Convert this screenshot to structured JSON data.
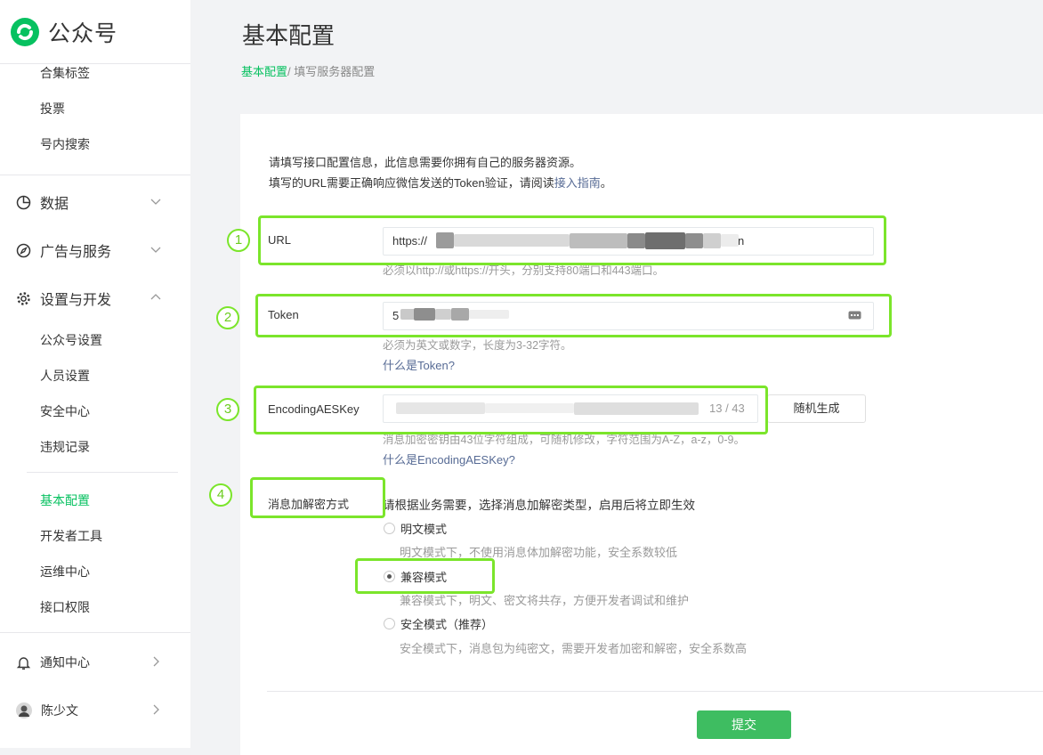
{
  "app": {
    "name": "公众号"
  },
  "sidebar": {
    "top_items": [
      "合集标签",
      "投票",
      "号内搜索"
    ],
    "sections": {
      "data": {
        "label": "数据"
      },
      "ads": {
        "label": "广告与服务"
      },
      "settings": {
        "label": "设置与开发"
      }
    },
    "settings_items": [
      "公众号设置",
      "人员设置",
      "安全中心",
      "违规记录"
    ],
    "dev_items": [
      "基本配置",
      "开发者工具",
      "运维中心",
      "接口权限"
    ],
    "notifications": {
      "label": "通知中心"
    },
    "user": {
      "name": "陈少文"
    }
  },
  "page": {
    "title": "基本配置",
    "breadcrumb": {
      "parent": "基本配置",
      "current": "/ 填写服务器配置"
    }
  },
  "form": {
    "intro_line1": "请填写接口配置信息，此信息需要你拥有自己的服务器资源。",
    "intro_line2_prefix": "填写的URL需要正确响应微信发送的Token验证，请阅读",
    "intro_link": "接入指南",
    "intro_line2_suffix": "。",
    "url": {
      "label": "URL",
      "value_prefix": "https://",
      "value_suffix": "n",
      "hint": "必须以http://或https://开头，分别支持80端口和443端口。"
    },
    "token": {
      "label": "Token",
      "value_prefix": "5",
      "hint": "必须为英文或数字，长度为3-32字符。",
      "link": "什么是Token?"
    },
    "aeskey": {
      "label": "EncodingAESKey",
      "counter": "13 / 43",
      "generate_label": "随机生成",
      "hint": "消息加密密钥由43位字符组成，可随机修改，字符范围为A-Z，a-z，0-9。",
      "link": "什么是EncodingAESKey?"
    },
    "encryption": {
      "label": "消息加解密方式",
      "intro": "请根据业务需要，选择消息加解密类型，启用后将立即生效",
      "options": [
        {
          "label": "明文模式",
          "desc": "明文模式下，不使用消息体加解密功能，安全系数较低"
        },
        {
          "label": "兼容模式",
          "desc": "兼容模式下，明文、密文将共存，方便开发者调试和维护"
        },
        {
          "label": "安全模式（推荐）",
          "desc": "安全模式下，消息包为纯密文，需要开发者加密和解密，安全系数高"
        }
      ],
      "selected": "兼容模式"
    },
    "submit_label": "提交"
  },
  "annotations": {
    "numbers": [
      "1",
      "2",
      "3",
      "4"
    ],
    "color": "#7be52b"
  },
  "colors": {
    "accent": "#07c160",
    "link": "#576b95",
    "submit": "#3ebd61"
  }
}
